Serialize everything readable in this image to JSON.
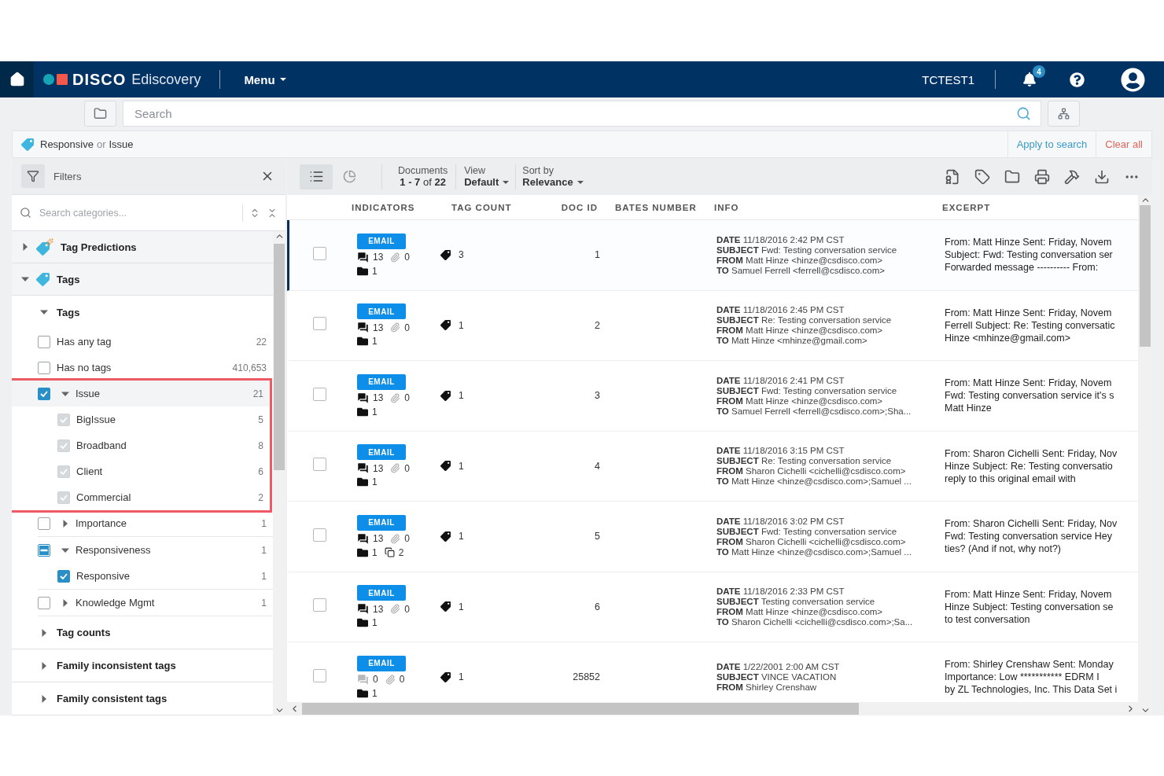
{
  "header": {
    "brand": "DISCO",
    "product": "Ediscovery",
    "menu": "Menu",
    "workspace": "TCTEST1",
    "notifications": "4"
  },
  "search_bar": {
    "placeholder": "Search"
  },
  "query_bar": {
    "query": [
      {
        "kind": "term",
        "text": "Responsive"
      },
      {
        "kind": "operator",
        "text": "or"
      },
      {
        "kind": "term",
        "text": "Issue"
      }
    ],
    "apply": "Apply to search",
    "clear": "Clear all"
  },
  "filters": {
    "title": "Filters",
    "placeholder": "Search categories...",
    "tree": [
      {
        "kind": "category",
        "label": "Tag Predictions",
        "expanded": false
      },
      {
        "kind": "category",
        "label": "Tags",
        "expanded": true,
        "children": [
          {
            "kind": "group",
            "label": "Tags",
            "expanded": true,
            "children": [
              {
                "kind": "tag",
                "label": "Has any tag",
                "count": "22",
                "checked": false
              },
              {
                "kind": "tag",
                "label": "Has no tags",
                "count": "410,653",
                "checked": false
              },
              {
                "kind": "tag",
                "label": "Issue",
                "count": "21",
                "checked": true,
                "inherited": false,
                "expanded": true,
                "highlighted": true,
                "children": [
                  {
                    "kind": "tag",
                    "label": "BigIssue",
                    "count": "5",
                    "checked": true,
                    "inherited": true
                  },
                  {
                    "kind": "tag",
                    "label": "Broadband",
                    "count": "8",
                    "checked": true,
                    "inherited": true
                  },
                  {
                    "kind": "tag",
                    "label": "Client",
                    "count": "6",
                    "checked": true,
                    "inherited": true
                  },
                  {
                    "kind": "tag",
                    "label": "Commercial",
                    "count": "2",
                    "checked": true,
                    "inherited": true
                  }
                ]
              },
              {
                "kind": "tag",
                "label": "Importance",
                "count": "1",
                "checked": false,
                "expanded": false
              },
              {
                "kind": "tag",
                "label": "Responsiveness",
                "count": "1",
                "checked": false,
                "partial": true,
                "expanded": true,
                "children": [
                  {
                    "kind": "tag",
                    "label": "Responsive",
                    "count": "1",
                    "checked": true,
                    "inherited": false
                  }
                ]
              },
              {
                "kind": "tag",
                "label": "Knowledge Mgmt",
                "count": "1",
                "checked": false,
                "expanded": false
              }
            ]
          },
          {
            "kind": "group",
            "label": "Tag counts",
            "expanded": false
          },
          {
            "kind": "group",
            "label": "Family inconsistent tags",
            "expanded": false
          },
          {
            "kind": "group",
            "label": "Family consistent tags",
            "expanded": false
          }
        ]
      }
    ]
  },
  "toolbar": {
    "views": [
      {
        "kind": "list",
        "selected": true
      },
      {
        "kind": "chart",
        "selected": false
      }
    ],
    "documents_label": "Documents",
    "documents_range": "**1 - 7** of **22**",
    "view_label": "View",
    "view_value": "Default",
    "sort_label": "Sort by",
    "sort_value": "Relevance"
  },
  "table": {
    "columns": [
      "INDICATORS",
      "TAG COUNT",
      "DOC ID",
      "BATES NUMBER",
      "INFO",
      "EXCERPT"
    ],
    "rows": [
      {
        "selected": true,
        "checked": false,
        "type": "EMAIL",
        "threads": "13",
        "threads_active": true,
        "attachments": "0",
        "folders": "1",
        "tags": "3",
        "doc_id": "1",
        "info": [
          "**DATE** 11/18/2016 2:42 PM CST",
          "**SUBJECT** Fwd: Testing conversation service",
          "**FROM** Matt Hinze <hinze@csdisco.com>",
          "**TO** Samuel Ferrell <ferrell@csdisco.com>"
        ],
        "excerpt": [
          "From: Matt Hinze Sent: Friday, Novem",
          "Subject: Fwd: Testing conversation ser",
          "Forwarded message ---------- From:"
        ]
      },
      {
        "selected": false,
        "checked": false,
        "type": "EMAIL",
        "threads": "13",
        "threads_active": true,
        "attachments": "0",
        "folders": "1",
        "tags": "1",
        "doc_id": "2",
        "info": [
          "**DATE** 11/18/2016 2:45 PM CST",
          "**SUBJECT** Re: Testing conversation service",
          "**FROM** Matt Hinze <hinze@csdisco.com>",
          "**TO** Matt Hinze <mhinze@gmail.com>"
        ],
        "excerpt": [
          "From: Matt Hinze Sent: Friday, Novem",
          "Ferrell Subject: Re: Testing conversatic",
          "Hinze <mhinze@gmail.com>"
        ]
      },
      {
        "selected": false,
        "checked": false,
        "type": "EMAIL",
        "threads": "13",
        "threads_active": true,
        "attachments": "0",
        "folders": "1",
        "tags": "1",
        "doc_id": "3",
        "info": [
          "**DATE** 11/18/2016 2:41 PM CST",
          "**SUBJECT** Fwd: Testing conversation service",
          "**FROM** Matt Hinze <hinze@csdisco.com>",
          "**TO** Samuel Ferrell <ferrell@csdisco.com>;Sha..."
        ],
        "excerpt": [
          "From: Matt Hinze Sent: Friday, Novem",
          "Fwd: Testing conversation service it's s",
          "Matt Hinze"
        ]
      },
      {
        "selected": false,
        "checked": false,
        "type": "EMAIL",
        "threads": "13",
        "threads_active": true,
        "attachments": "0",
        "folders": "1",
        "tags": "1",
        "doc_id": "4",
        "info": [
          "**DATE** 11/18/2016 3:15 PM CST",
          "**SUBJECT** Re: Testing conversation service",
          "**FROM** Sharon Cichelli <cichelli@csdisco.com>",
          "**TO** Matt Hinze <hinze@csdisco.com>;Samuel ..."
        ],
        "excerpt": [
          "From: Sharon Cichelli Sent: Friday, Nov",
          "Hinze Subject: Re: Testing conversatio",
          "reply to this original email with"
        ]
      },
      {
        "selected": false,
        "checked": false,
        "type": "EMAIL",
        "threads": "13",
        "threads_active": true,
        "attachments": "0",
        "folders": "1",
        "duplicates": "2",
        "tags": "1",
        "doc_id": "5",
        "info": [
          "**DATE** 11/18/2016 3:02 PM CST",
          "**SUBJECT** Fwd: Testing conversation service",
          "**FROM** Sharon Cichelli <cichelli@csdisco.com>",
          "**TO** Matt Hinze <hinze@csdisco.com>;Samuel ..."
        ],
        "excerpt": [
          "From: Sharon Cichelli Sent: Friday, Nov",
          "Fwd: Testing conversation service Hey",
          "ties? (And if not, why not?)"
        ]
      },
      {
        "selected": false,
        "checked": false,
        "type": "EMAIL",
        "threads": "13",
        "threads_active": true,
        "attachments": "0",
        "folders": "1",
        "tags": "1",
        "doc_id": "6",
        "info": [
          "**DATE** 11/18/2016 2:33 PM CST",
          "**SUBJECT** Testing conversation service",
          "**FROM** Matt Hinze <hinze@csdisco.com>",
          "**TO** Sharon Cichelli <cichelli@csdisco.com>;Sa..."
        ],
        "excerpt": [
          "From: Matt Hinze Sent: Friday, Novem",
          "Hinze Subject: Testing conversation se",
          "to test conversation"
        ]
      },
      {
        "selected": false,
        "checked": false,
        "type": "EMAIL",
        "threads": "0",
        "threads_active": false,
        "attachments": "0",
        "folders": "1",
        "tags": "1",
        "doc_id": "25852",
        "info": [
          "**DATE** 1/22/2001 2:00 AM CST",
          "**SUBJECT** VINCE VACATION",
          "**FROM** Shirley Crenshaw"
        ],
        "excerpt": [
          "From: Shirley Crenshaw Sent: Monday",
          "Importance: Low *********** EDRM I",
          "by ZL Technologies, Inc. This Data Set i"
        ]
      }
    ]
  }
}
